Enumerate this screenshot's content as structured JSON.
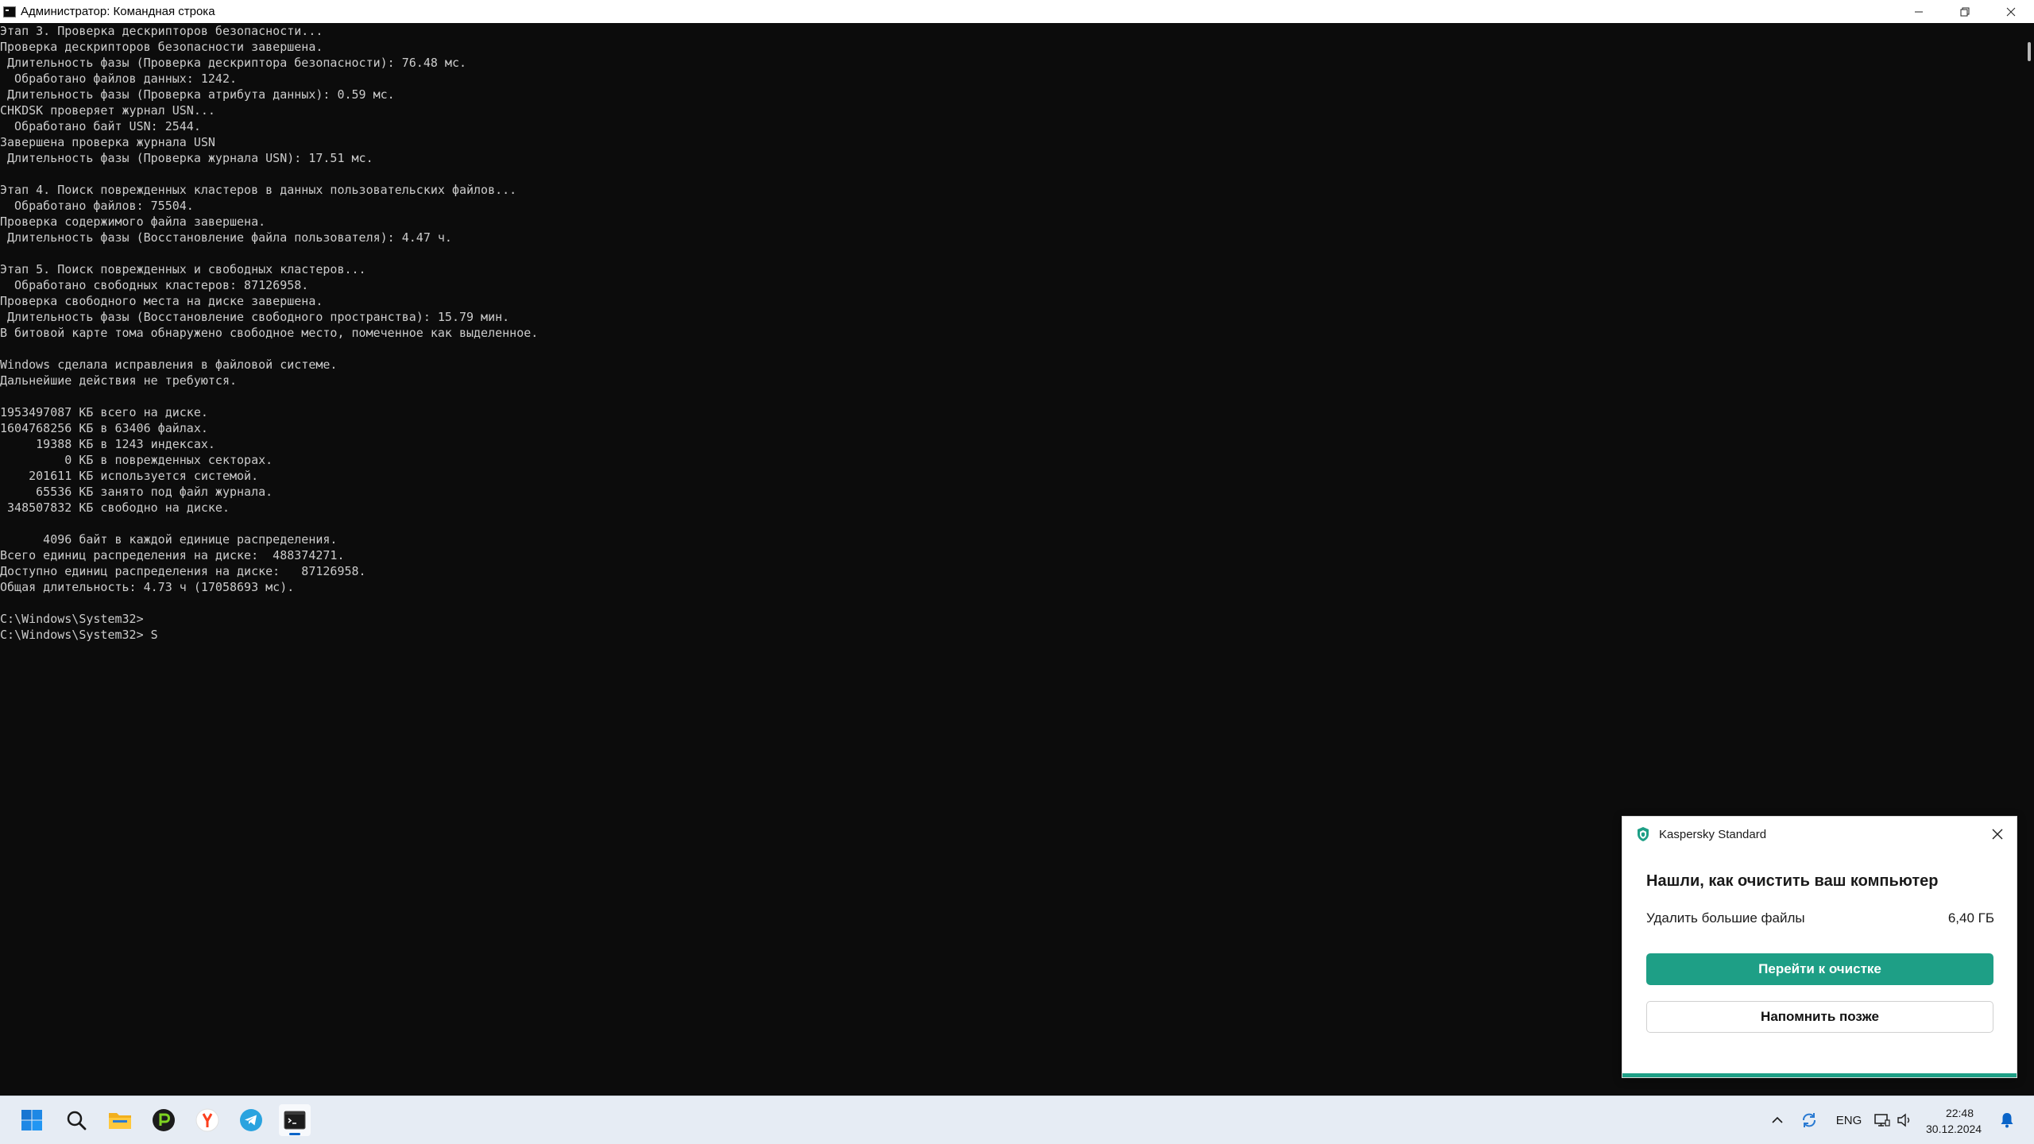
{
  "window": {
    "title": "Администратор: Командная строка",
    "icon": "console-icon",
    "controls": [
      "minimize-icon",
      "restore-icon",
      "close-icon"
    ]
  },
  "console": {
    "lines": [
      "Этап 3. Проверка дескрипторов безопасности...",
      "Проверка дескрипторов безопасности завершена.",
      " Длительность фазы (Проверка дескриптора безопасности): 76.48 мс.",
      "  Обработано файлов данных: 1242.",
      " Длительность фазы (Проверка атрибута данных): 0.59 мс.",
      "CHKDSK проверяет журнал USN...",
      "  Обработано байт USN: 2544.",
      "Завершена проверка журнала USN",
      " Длительность фазы (Проверка журнала USN): 17.51 мс.",
      "",
      "Этап 4. Поиск поврежденных кластеров в данных пользовательских файлов...",
      "  Обработано файлов: 75504.",
      "Проверка содержимого файла завершена.",
      " Длительность фазы (Восстановление файла пользователя): 4.47 ч.",
      "",
      "Этап 5. Поиск поврежденных и свободных кластеров...",
      "  Обработано свободных кластеров: 87126958.",
      "Проверка свободного места на диске завершена.",
      " Длительность фазы (Восстановление свободного пространства): 15.79 мин.",
      "В битовой карте тома обнаружено свободное место, помеченное как выделенное.",
      "",
      "Windows сделала исправления в файловой системе.",
      "Дальнейшие действия не требуются.",
      "",
      "1953497087 КБ всего на диске.",
      "1604768256 КБ в 63406 файлах.",
      "     19388 КБ в 1243 индексах.",
      "         0 КБ в поврежденных секторах.",
      "    201611 КБ используется системой.",
      "     65536 КБ занято под файл журнала.",
      " 348507832 КБ свободно на диске.",
      "",
      "      4096 байт в каждой единице распределения.",
      "Всего единиц распределения на диске:  488374271.",
      "Доступно единиц распределения на диске:   87126958.",
      "Общая длительность: 4.73 ч (17058693 мс).",
      "",
      "C:\\Windows\\System32>",
      "C:\\Windows\\System32> S"
    ]
  },
  "toast": {
    "app_name": "Kaspersky Standard",
    "app_icon": "kaspersky-shield-icon",
    "title": "Нашли, как очистить ваш компьютер",
    "item_label": "Удалить большие файлы",
    "item_value": "6,40 ГБ",
    "primary_button": "Перейти к очистке",
    "secondary_button": "Напомнить позже",
    "accent_color": "#1e9f86"
  },
  "taskbar": {
    "apps": [
      "start-icon",
      "search-icon",
      "file-explorer-icon",
      "p-app-icon",
      "yandex-browser-icon",
      "telegram-icon",
      "terminal-icon"
    ],
    "tray": {
      "language": "ENG",
      "time": "22:48",
      "date": "30.12.2024"
    }
  }
}
